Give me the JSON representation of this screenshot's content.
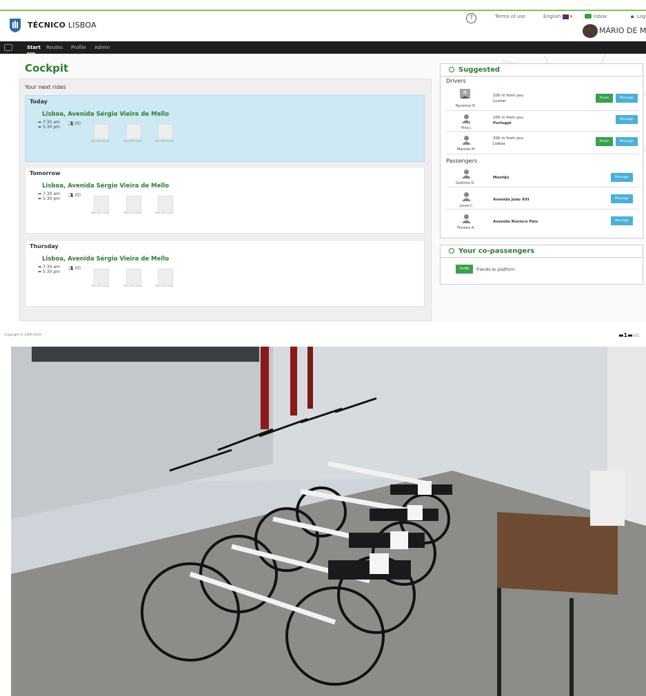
{
  "header": {
    "brand_bold": "TÉCNICO",
    "brand_light": "LISBOA",
    "help_symbol": "?",
    "terms_link": "Terms of use",
    "language": "English",
    "inbox_label": "Inbox",
    "logout_label": "Logo",
    "user_name": "MÁRIO DE MATO"
  },
  "nav": {
    "items": [
      "Start",
      "Routes",
      "Profile",
      "Admin"
    ]
  },
  "cockpit": {
    "title": "Cockpit",
    "panel_heading": "Your next rides",
    "rides": [
      {
        "day": "Today",
        "route": "Lisboa, Avenida Sérgio Vieira de Mello",
        "depart": "7:30 am",
        "return": "5:30 pm",
        "passengers": "(0)",
        "seats": [
          "Vacant seat",
          "Vacant seat",
          "Vacant seat"
        ]
      },
      {
        "day": "Tomorrow",
        "route": "Lisboa, Avenida Sérgio Vieira de Mello",
        "depart": "7:30 am",
        "return": "5:30 pm",
        "passengers": "(0)",
        "seats": [
          "Vacant seat",
          "Vacant seat",
          "Vacant seat"
        ]
      },
      {
        "day": "Thursday",
        "route": "Lisboa, Avenida Sérgio Vieira de Mello",
        "depart": "7:30 am",
        "return": "5:30 pm",
        "passengers": "(0)",
        "seats": [
          "Vacant seat",
          "Vacant seat",
          "Vacant seat"
        ]
      }
    ]
  },
  "suggested": {
    "title": "Suggested",
    "drivers_heading": "Drivers",
    "drivers": [
      {
        "name": "Barreiros R.",
        "distance": "200 m from you",
        "place": "Lumiar",
        "route_btn": "Route",
        "message_btn": "Message"
      },
      {
        "name": "Pina J.",
        "distance": "200 m from you",
        "place": "Portugal",
        "message_btn": "Message"
      },
      {
        "name": "Macedo M.",
        "distance": "200 m from you",
        "place": "Lisboa",
        "route_btn": "Route",
        "message_btn": "Message"
      }
    ],
    "passengers_heading": "Passengers",
    "passengers": [
      {
        "name": "Godinho D.",
        "place": "Montijo",
        "message_btn": "Message"
      },
      {
        "name": "Jones C.",
        "place": "Avenida João XXI",
        "message_btn": "Message"
      },
      {
        "name": "Ferreira A.",
        "place": "Avenida Rovisco Pais",
        "message_btn": "Message"
      }
    ]
  },
  "copassengers": {
    "title": "Your co-passengers",
    "invite_btn": "Invite",
    "invite_text": "friends to platform"
  },
  "footer": {
    "copyright": "Copyright © 2009-2019",
    "logo_text": "VEL"
  },
  "colors": {
    "accent_green": "#2e7d32",
    "button_green": "#3aa04a",
    "button_blue": "#4ab0da",
    "navbar": "#1e1e1e",
    "today_card": "#cde9f3"
  }
}
